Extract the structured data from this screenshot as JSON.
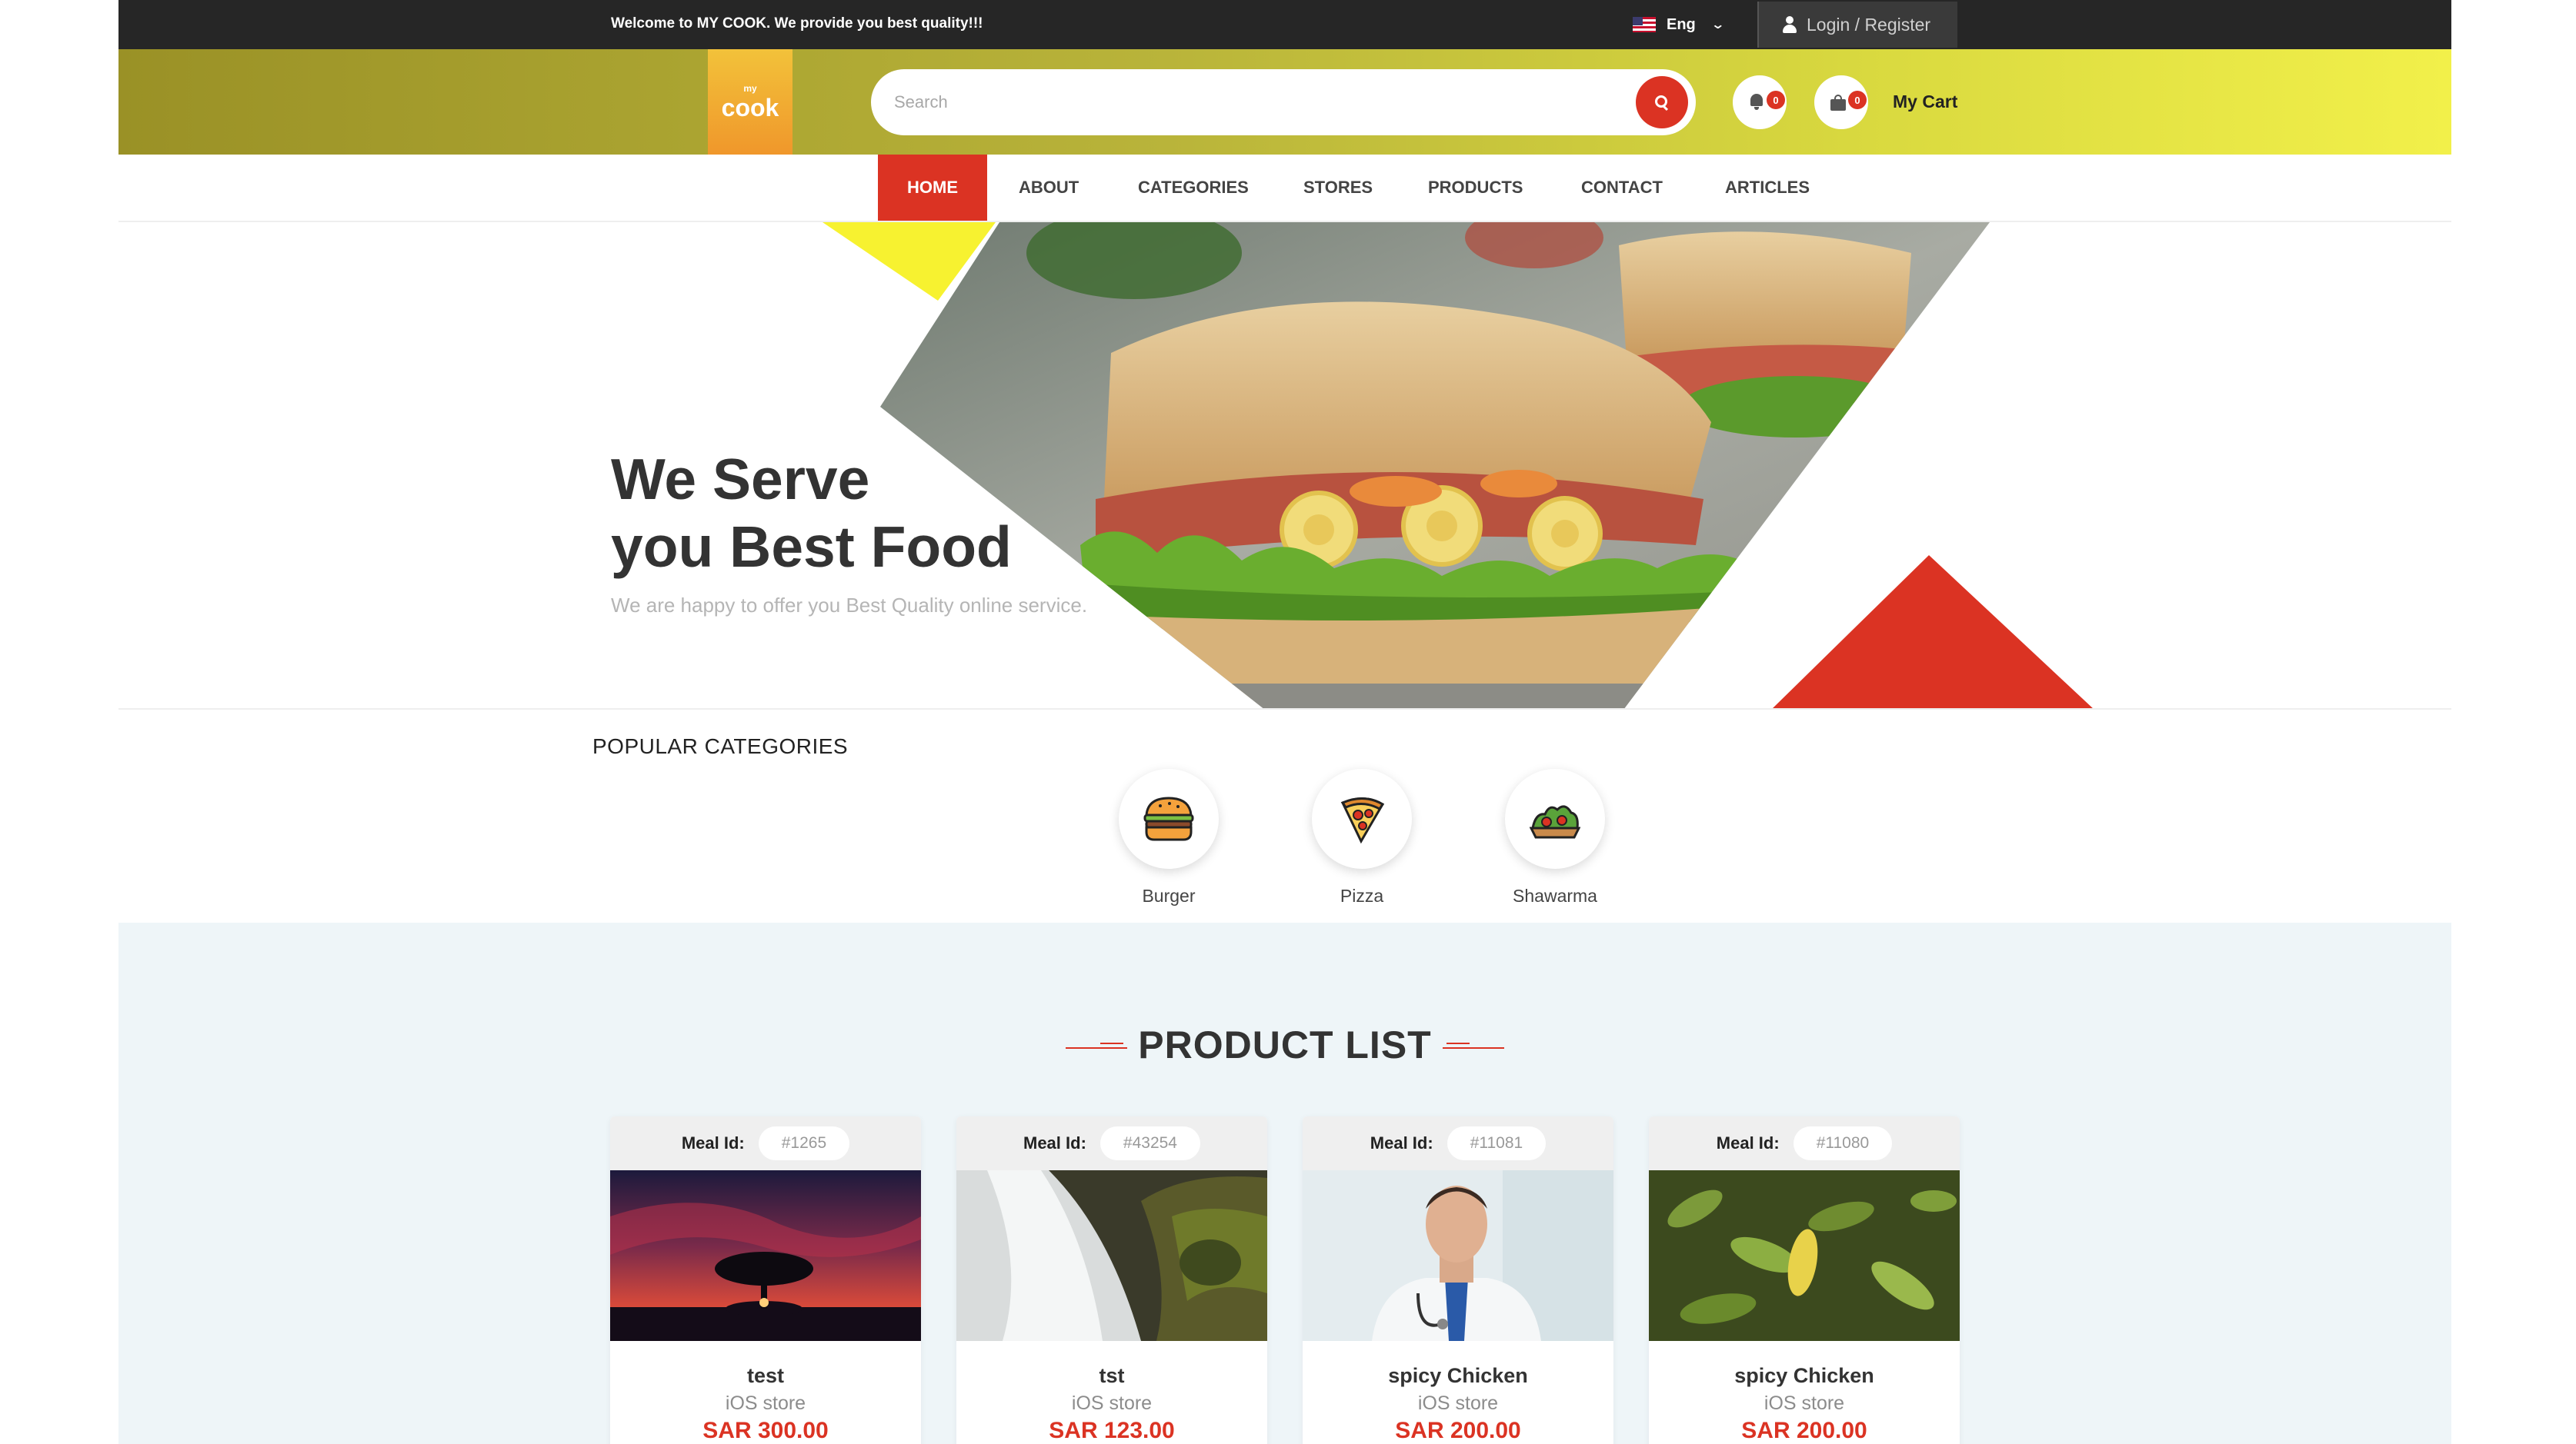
{
  "topbar": {
    "welcome_prefix": "Welcome to ",
    "welcome_brand": "MY COOK",
    "welcome_suffix": ". We provide you best quality!!!",
    "language": "Eng",
    "login_label": "Login / Register"
  },
  "header": {
    "logo_small": "my",
    "logo_big": "cook",
    "search_placeholder": "Search",
    "notifications_count": "0",
    "cart_count": "0",
    "cart_label": "My Cart"
  },
  "nav": {
    "items": [
      "HOME",
      "ABOUT",
      "CATEGORIES",
      "STORES",
      "PRODUCTS",
      "CONTACT",
      "ARTICLES"
    ],
    "active": "HOME"
  },
  "hero": {
    "title_line1": "We Serve",
    "title_line2": "you Best Food",
    "subtitle": "We are happy to offer you Best Quality online service."
  },
  "categories": {
    "title": "POPULAR CATEGORIES",
    "items": [
      {
        "label": "Burger",
        "icon": "burger-icon"
      },
      {
        "label": "Pizza",
        "icon": "pizza-icon"
      },
      {
        "label": "Shawarma",
        "icon": "shawarma-icon"
      }
    ]
  },
  "product_list": {
    "title": "PRODUCT LIST",
    "meal_id_label": "Meal Id:",
    "products": [
      {
        "id": "#1265",
        "name": "test",
        "store": "iOS store",
        "price": "SAR 300.00",
        "image": "sunset-tree-photo"
      },
      {
        "id": "#43254",
        "name": "tst",
        "store": "iOS store",
        "price": "SAR 123.00",
        "image": "waterfall-photo"
      },
      {
        "id": "#11081",
        "name": "spicy Chicken",
        "store": "iOS store",
        "price": "SAR 200.00",
        "image": "doctor-photo"
      },
      {
        "id": "#11080",
        "name": "spicy Chicken",
        "store": "iOS store",
        "price": "SAR 200.00",
        "image": "leaves-photo"
      }
    ]
  },
  "colors": {
    "accent": "#db3323",
    "topbar": "#262626",
    "header_gradient_start": "#9a9126",
    "header_gradient_end": "#f2f04a",
    "product_section_bg": "#eef5f8"
  }
}
